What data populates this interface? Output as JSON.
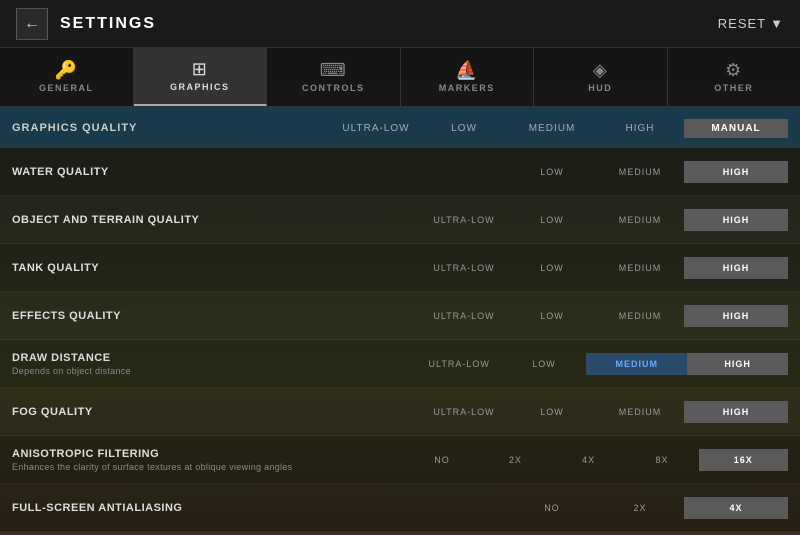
{
  "header": {
    "back_label": "←",
    "title": "SETTINGS",
    "reset_label": "RESET",
    "reset_chevron": "▼"
  },
  "tabs": [
    {
      "id": "general",
      "label": "GENERAL",
      "icon": "🔑",
      "active": false
    },
    {
      "id": "graphics",
      "label": "GRAPHICS",
      "icon": "⊞",
      "active": true
    },
    {
      "id": "controls",
      "label": "CONTROLS",
      "icon": "⌨",
      "active": false
    },
    {
      "id": "markers",
      "label": "MARKERS",
      "icon": "⛵",
      "active": false
    },
    {
      "id": "hud",
      "label": "HUD",
      "icon": "◈",
      "active": false
    },
    {
      "id": "other",
      "label": "OTHER",
      "icon": "⚙",
      "active": false
    }
  ],
  "quality_header": {
    "label": "GRAPHICS QUALITY",
    "options": [
      "ULTRA-LOW",
      "LOW",
      "MEDIUM",
      "HIGH",
      "MANUAL"
    ],
    "selected": "MANUAL"
  },
  "settings": [
    {
      "name": "WATER QUALITY",
      "desc": "",
      "options": [
        "LOW",
        "MEDIUM",
        "HIGH"
      ],
      "has_ultra_low": false,
      "selected": "HIGH"
    },
    {
      "name": "OBJECT AND TERRAIN QUALITY",
      "desc": "",
      "options": [
        "ULTRA-LOW",
        "LOW",
        "MEDIUM",
        "HIGH"
      ],
      "has_ultra_low": true,
      "selected": "HIGH"
    },
    {
      "name": "TANK QUALITY",
      "desc": "",
      "options": [
        "ULTRA-LOW",
        "LOW",
        "MEDIUM",
        "HIGH"
      ],
      "has_ultra_low": true,
      "selected": "HIGH"
    },
    {
      "name": "EFFECTS QUALITY",
      "desc": "",
      "options": [
        "ULTRA-LOW",
        "LOW",
        "MEDIUM",
        "HIGH"
      ],
      "has_ultra_low": true,
      "selected": "HIGH"
    },
    {
      "name": "DRAW DISTANCE",
      "desc": "Depends on object distance",
      "options": [
        "ULTRA-LOW",
        "LOW",
        "MEDIUM",
        "HIGH"
      ],
      "has_ultra_low": true,
      "selected": "HIGH"
    },
    {
      "name": "FOG QUALITY",
      "desc": "",
      "options": [
        "ULTRA-LOW",
        "LOW",
        "MEDIUM",
        "HIGH"
      ],
      "has_ultra_low": true,
      "selected": "HIGH"
    },
    {
      "name": "ANISOTROPIC FILTERING",
      "desc": "Enhances the clarity of surface textures at oblique viewing angles",
      "options": [
        "NO",
        "2X",
        "4X",
        "8X",
        "16X"
      ],
      "has_ultra_low": false,
      "selected": "16X"
    },
    {
      "name": "FULL-SCREEN ANTIALIASING",
      "desc": "",
      "options": [
        "NO",
        "2X",
        "4X"
      ],
      "has_ultra_low": false,
      "selected": "4X"
    }
  ]
}
